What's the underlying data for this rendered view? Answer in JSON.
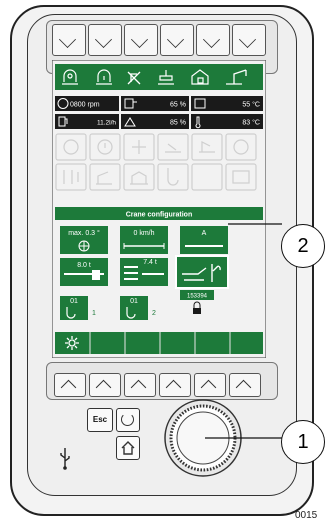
{
  "colors": {
    "accent": "#1d7a3a",
    "screen_bg": "#eeeeee",
    "ghost": "#cfcfcf",
    "device": "#f1f1f1"
  },
  "header_icons": [
    "seat-icon",
    "cab-height-icon",
    "no-crane-icon",
    "hook-icon",
    "cab-lock-icon",
    "crane-arm-icon"
  ],
  "status": {
    "rpm": "0800 rpm",
    "fuel_rate": "11.2l/h",
    "hydraulic_1": "65 %",
    "hydraulic_2": "85 %",
    "temp_1": "55 °C",
    "temp_2": "83 °C"
  },
  "crane": {
    "title": "Crane configuration",
    "tilt": "max. 0.3 °",
    "speed": "0 km/h",
    "mode": "A",
    "load_1": "8.0 t",
    "load_2": "7.4 t",
    "hook_1_top": "01",
    "hook_1_num": "1",
    "hook_2_top": "01",
    "hook_2_num": "2",
    "id": "153394"
  },
  "keys": {
    "esc": "Esc"
  },
  "callouts": {
    "settings": "2",
    "rotary": "1"
  },
  "figure_id": "0015"
}
